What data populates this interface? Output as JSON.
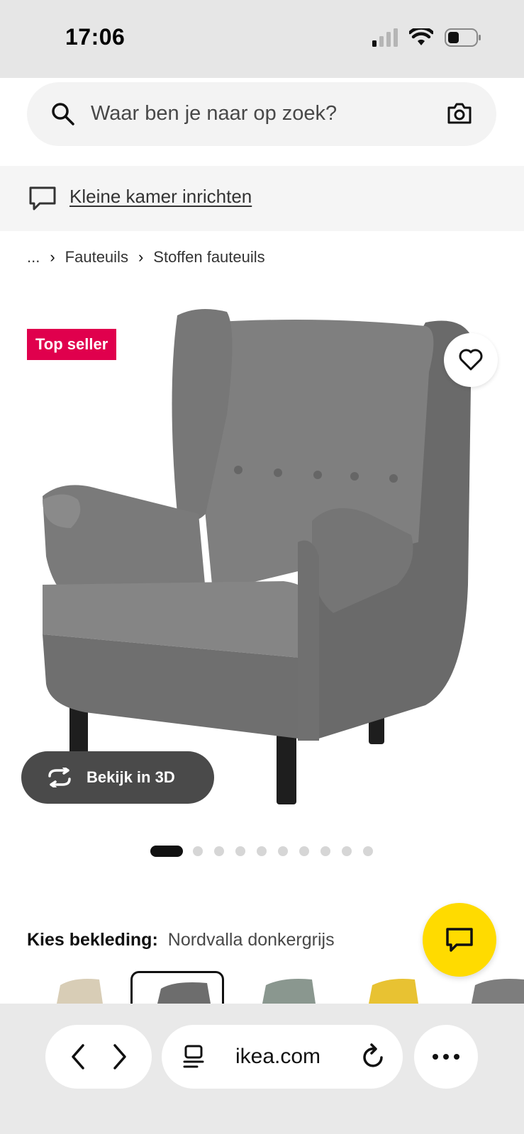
{
  "status_bar": {
    "time": "17:06",
    "icons": [
      "signal-icon",
      "wifi-icon",
      "battery-icon"
    ]
  },
  "search": {
    "placeholder": "Waar ben je naar op zoek?"
  },
  "promo": {
    "link_text": "Kleine kamer inrichten"
  },
  "breadcrumb": {
    "ellipsis": "...",
    "items": [
      "Fauteuils",
      "Stoffen fauteuils"
    ]
  },
  "product": {
    "badge": "Top seller",
    "view_3d_label": "Bekijk in 3D",
    "image_count": 10,
    "active_image": 1,
    "upholstery_label": "Kies bekleding:",
    "upholstery_value": "Nordvalla donkergrijs",
    "variants": [
      "beige",
      "donkergrijs",
      "geruit groen",
      "geel",
      "grijs"
    ],
    "selected_variant": 1
  },
  "browser": {
    "url": "ikea.com"
  },
  "colors": {
    "badge": "#e0004d",
    "chat_fab": "#ffdb00",
    "chair": "#7a7a7a",
    "button_dark": "#4a4a4a"
  }
}
